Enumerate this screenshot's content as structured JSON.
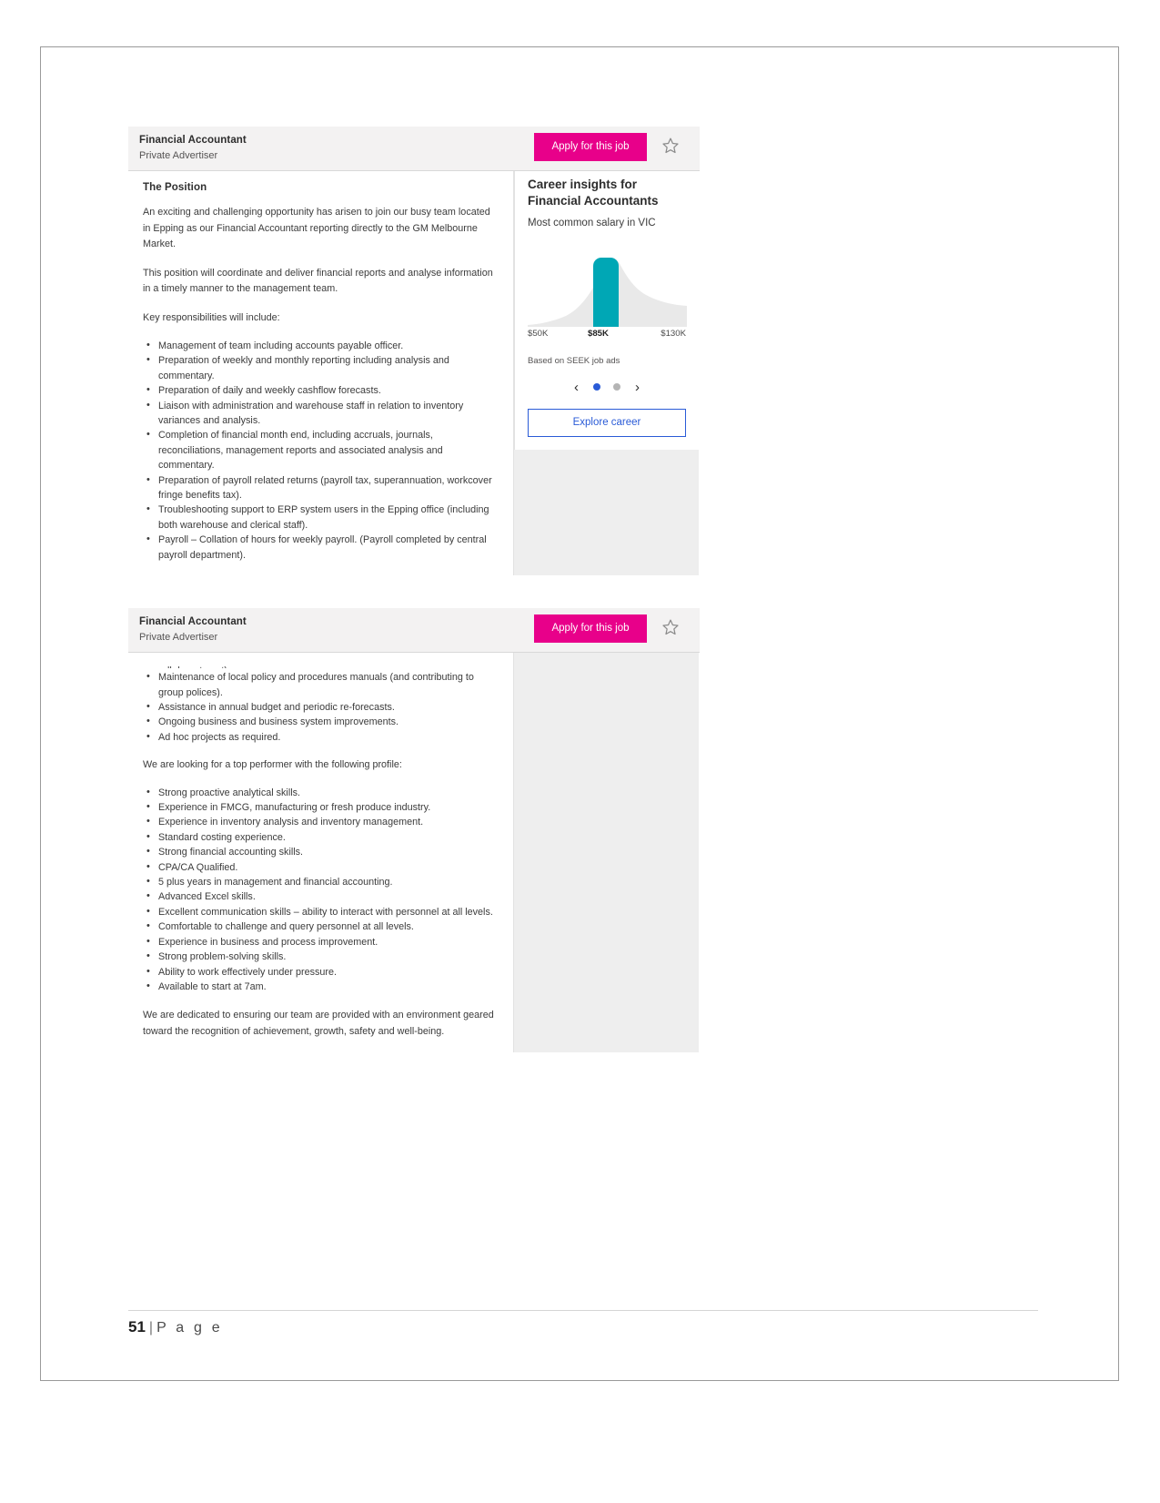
{
  "document": {
    "footer": {
      "page_number": "51",
      "separator": "|",
      "page_word": "P a g e"
    }
  },
  "job_card_top": {
    "title": "Financial Accountant",
    "advertiser": "Private Advertiser",
    "apply_label": "Apply for this job",
    "save_icon": "star-outline-icon",
    "section_heading": "The Position",
    "paragraphs": [
      "An exciting and challenging opportunity has arisen to join our busy team located in Epping as our Financial Accountant reporting directly to the GM Melbourne Market.",
      "This position will coordinate and deliver financial reports and analyse information in a timely manner to the management team.",
      "Key responsibilities will include:"
    ],
    "responsibilities": [
      "Management of team including accounts payable officer.",
      "Preparation of weekly and monthly reporting including analysis and commentary.",
      "Preparation of daily and weekly cashflow forecasts.",
      "Liaison with administration and warehouse staff in relation to inventory variances and analysis.",
      "Completion of financial month end, including accruals, journals, reconciliations, management reports and associated analysis and commentary.",
      "Preparation of payroll related returns (payroll tax, superannuation, workcover fringe benefits tax).",
      "Troubleshooting support to ERP system users in the Epping office (including both warehouse and clerical staff).",
      "Payroll – Collation of hours for weekly payroll. (Payroll completed by central payroll department)."
    ]
  },
  "career_insights": {
    "title_line1": "Career insights for",
    "title_line2": "Financial Accountants",
    "subtitle": "Most common salary in VIC",
    "source": "Based on SEEK job ads",
    "explore_label": "Explore career",
    "prev_icon": "chevron-left-icon",
    "next_icon": "chevron-right-icon",
    "dots": [
      "active",
      "inactive"
    ],
    "accent_color": "#00a7b5",
    "link_color": "#2a5bd7",
    "chart_data": {
      "type": "area",
      "title": "Most common salary in VIC",
      "xlabel": "",
      "ylabel": "",
      "tick_labels": [
        "$50K",
        "$85K",
        "$130K"
      ],
      "highlight_value": "$85K",
      "xlim": [
        50,
        130
      ],
      "curve_points": [
        {
          "x": 50,
          "y": 2
        },
        {
          "x": 57,
          "y": 5
        },
        {
          "x": 64,
          "y": 12
        },
        {
          "x": 71,
          "y": 30
        },
        {
          "x": 78,
          "y": 62
        },
        {
          "x": 83,
          "y": 88
        },
        {
          "x": 86,
          "y": 100
        },
        {
          "x": 90,
          "y": 92
        },
        {
          "x": 97,
          "y": 70
        },
        {
          "x": 104,
          "y": 55
        },
        {
          "x": 112,
          "y": 44
        },
        {
          "x": 120,
          "y": 36
        },
        {
          "x": 130,
          "y": 30
        }
      ],
      "highlight_bar": {
        "x_start": 83,
        "x_end": 90,
        "height": 100
      },
      "grid": false,
      "legend": "none"
    }
  },
  "job_card_bottom": {
    "title": "Financial Accountant",
    "advertiser": "Private Advertiser",
    "apply_label": "Apply for this job",
    "save_icon": "star-outline-icon",
    "truncated_line": "payroll department).",
    "responsibilities_continued": [
      "Maintenance of local policy and procedures manuals (and contributing to group polices).",
      "Assistance in annual budget and periodic re-forecasts.",
      "Ongoing business and business system improvements.",
      "Ad hoc projects as required."
    ],
    "profile_intro": "We are looking for a top performer with the following profile:",
    "profile_items": [
      "Strong proactive analytical skills.",
      "Experience in FMCG, manufacturing or fresh produce industry.",
      "Experience in inventory analysis and inventory management.",
      "Standard costing experience.",
      "Strong financial accounting skills.",
      "CPA/CA Qualified.",
      "5 plus years in management and financial accounting.",
      "Advanced Excel skills.",
      "Excellent communication skills – ability to interact with personnel at all levels.",
      "Comfortable to challenge and query personnel at all levels.",
      "Experience in business and process improvement.",
      "Strong problem-solving skills.",
      "Ability to work effectively under pressure.",
      "Available to start at 7am."
    ],
    "closing_paragraph": "We are dedicated to ensuring our team are provided with an environment geared toward the recognition of achievement, growth, safety and well-being."
  }
}
